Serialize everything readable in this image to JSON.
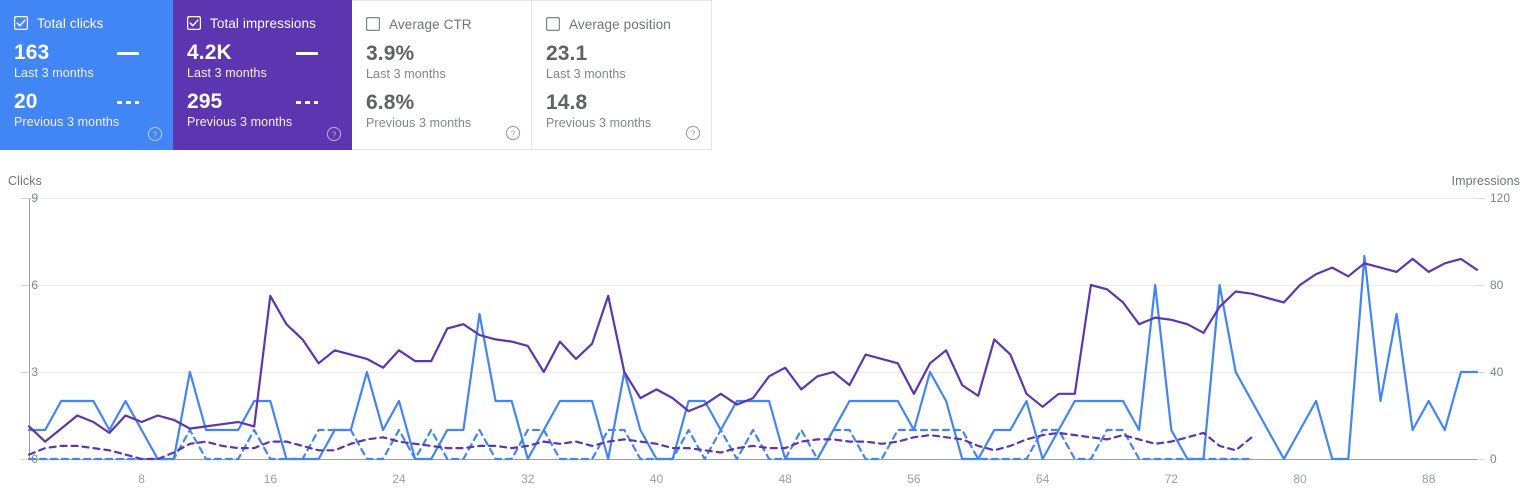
{
  "cards": [
    {
      "id": "total-clicks",
      "title": "Total clicks",
      "checked": true,
      "current_value": "163",
      "current_label": "Last 3 months",
      "previous_value": "20",
      "previous_label": "Previous 3 months",
      "color": "#4285f4",
      "help": "?"
    },
    {
      "id": "total-impressions",
      "title": "Total impressions",
      "checked": true,
      "current_value": "4.2K",
      "current_label": "Last 3 months",
      "previous_value": "295",
      "previous_label": "Previous 3 months",
      "color": "#5e35b1",
      "help": "?"
    },
    {
      "id": "average-ctr",
      "title": "Average CTR",
      "checked": false,
      "current_value": "3.9%",
      "current_label": "Last 3 months",
      "previous_value": "6.8%",
      "previous_label": "Previous 3 months",
      "color": "#ffffff",
      "help": "?"
    },
    {
      "id": "average-position",
      "title": "Average position",
      "checked": false,
      "current_value": "23.1",
      "current_label": "Last 3 months",
      "previous_value": "14.8",
      "previous_label": "Previous 3 months",
      "color": "#ffffff",
      "help": "?"
    }
  ],
  "chart_data": {
    "type": "line",
    "title": "",
    "xlabel": "",
    "ylabel": "Clicks",
    "y2label": "Impressions",
    "grid": true,
    "legend_position": "cards-above",
    "y_axis_left": {
      "label": "Clicks",
      "ticks": [
        "0",
        "3",
        "6",
        "9"
      ],
      "ylim": [
        0,
        9
      ]
    },
    "y_axis_right": {
      "label": "Impressions",
      "ticks": [
        "0",
        "40",
        "80",
        "120"
      ],
      "ylim": [
        0,
        120
      ]
    },
    "x_ticks": [
      "8",
      "16",
      "24",
      "32",
      "40",
      "48",
      "56",
      "64",
      "72",
      "80",
      "88"
    ],
    "xlim": [
      1,
      91
    ],
    "series": [
      {
        "name": "Total clicks",
        "axis": "left",
        "color": "#4285f4",
        "style": "solid",
        "values": [
          1,
          1,
          2,
          2,
          2,
          1,
          2,
          1,
          0,
          0,
          3,
          1,
          1,
          1,
          2,
          2,
          0,
          0,
          0,
          1,
          1,
          3,
          1,
          2,
          0,
          0,
          1,
          1,
          5,
          2,
          2,
          0,
          1,
          2,
          2,
          2,
          0,
          3,
          1,
          0,
          0,
          2,
          2,
          1,
          2,
          2,
          2,
          0,
          0,
          0,
          1,
          2,
          2,
          2,
          2,
          1,
          3,
          2,
          0,
          0,
          1,
          1,
          2,
          0,
          1,
          2,
          2,
          2,
          2,
          1,
          6,
          1,
          0,
          0,
          6,
          3,
          2,
          1,
          0,
          1,
          2,
          0,
          0,
          7,
          2,
          5,
          1,
          2,
          1,
          3,
          3
        ]
      },
      {
        "name": "Total clicks (previous period)",
        "axis": "left",
        "color": "#4285f4",
        "style": "dashed",
        "values": [
          0,
          0,
          0,
          0,
          0,
          0,
          0,
          0,
          0,
          0,
          1,
          0,
          0,
          0,
          1,
          0,
          0,
          0,
          1,
          1,
          1,
          0,
          0,
          1,
          0,
          1,
          0,
          0,
          1,
          0,
          0,
          1,
          1,
          0,
          0,
          0,
          1,
          1,
          0,
          0,
          0,
          1,
          0,
          1,
          0,
          1,
          0,
          0,
          1,
          0,
          1,
          1,
          0,
          0,
          1,
          1,
          1,
          1,
          1,
          0,
          0,
          0,
          0,
          1,
          1,
          0,
          0,
          1,
          1,
          0,
          0,
          0,
          0,
          0,
          0,
          0,
          0
        ]
      },
      {
        "name": "Total impressions",
        "axis": "right",
        "color": "#5e35b1",
        "style": "solid",
        "values": [
          15,
          8,
          14,
          20,
          17,
          12,
          20,
          17,
          20,
          18,
          14,
          15,
          16,
          17,
          15,
          75,
          62,
          55,
          44,
          50,
          48,
          46,
          42,
          50,
          45,
          45,
          60,
          62,
          57,
          55,
          54,
          52,
          40,
          54,
          46,
          53,
          75,
          40,
          28,
          32,
          28,
          22,
          25,
          30,
          25,
          28,
          38,
          42,
          32,
          38,
          40,
          34,
          48,
          46,
          44,
          30,
          44,
          50,
          34,
          29,
          55,
          48,
          30,
          24,
          30,
          30,
          80,
          78,
          72,
          62,
          65,
          64,
          62,
          58,
          70,
          77,
          76,
          74,
          72,
          80,
          85,
          88,
          84,
          90,
          88,
          86,
          92,
          86,
          90,
          92,
          87
        ]
      },
      {
        "name": "Total impressions (previous period)",
        "axis": "right",
        "color": "#5e35b1",
        "style": "dashed",
        "values": [
          2,
          5,
          6,
          6,
          5,
          4,
          2,
          0,
          0,
          3,
          7,
          8,
          6,
          5,
          5,
          8,
          8,
          6,
          4,
          4,
          7,
          9,
          10,
          8,
          7,
          6,
          5,
          5,
          6,
          6,
          5,
          6,
          8,
          7,
          8,
          6,
          8,
          9,
          8,
          7,
          5,
          5,
          4,
          3,
          5,
          6,
          5,
          5,
          8,
          9,
          9,
          8,
          8,
          7,
          8,
          10,
          11,
          10,
          9,
          6,
          4,
          6,
          9,
          11,
          12,
          11,
          10,
          9,
          11,
          9,
          7,
          8,
          10,
          12,
          6,
          4,
          10
        ]
      }
    ]
  }
}
